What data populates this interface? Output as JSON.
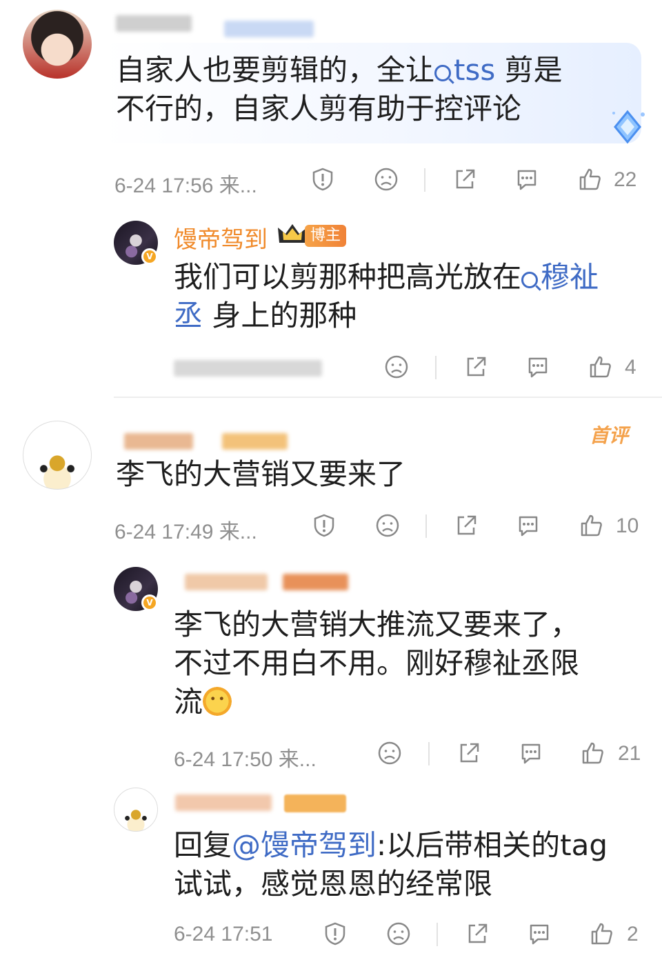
{
  "comments": [
    {
      "text_line1": "自家人也要剪辑的，全让",
      "link1": "tss",
      "text_line1_end": " 剪是",
      "text_line2": "不行的，自家人剪有助于控评论",
      "time": "6-24 17:56",
      "source": "来...",
      "likes": "22"
    },
    {
      "author": "馒帝驾到",
      "badge": "博主",
      "text_line1": "我们可以剪那种把高光放在",
      "link1": "穆祉",
      "link2": "丞",
      "text_line2_end": " 身上的那种",
      "likes": "4"
    },
    {
      "first_tag": "首评",
      "text": "李飞的大营销又要来了",
      "time": "6-24 17:49",
      "source": "来...",
      "likes": "10"
    },
    {
      "text_line1": "李飞的大营销大推流又要来了，",
      "text_line2": "不过不用白不用。刚好穆祉丞限",
      "text_line3": "流",
      "time": "6-24 17:50",
      "source": "来...",
      "likes": "21"
    },
    {
      "reply_prefix": "回复",
      "mention": "@馒帝驾到",
      "text_line1_end": ":以后带相关的tag",
      "text_line2": "试试，感觉恩恩的经常限",
      "time": "6-24 17:51",
      "likes": "2"
    }
  ],
  "icons": [
    "report-icon",
    "dislike-icon",
    "share-icon",
    "reply-icon",
    "like-icon"
  ],
  "colors": {
    "accent": "#3f6bc5",
    "name_orange": "#f08a2a",
    "meta_gray": "#8f8f8f"
  }
}
